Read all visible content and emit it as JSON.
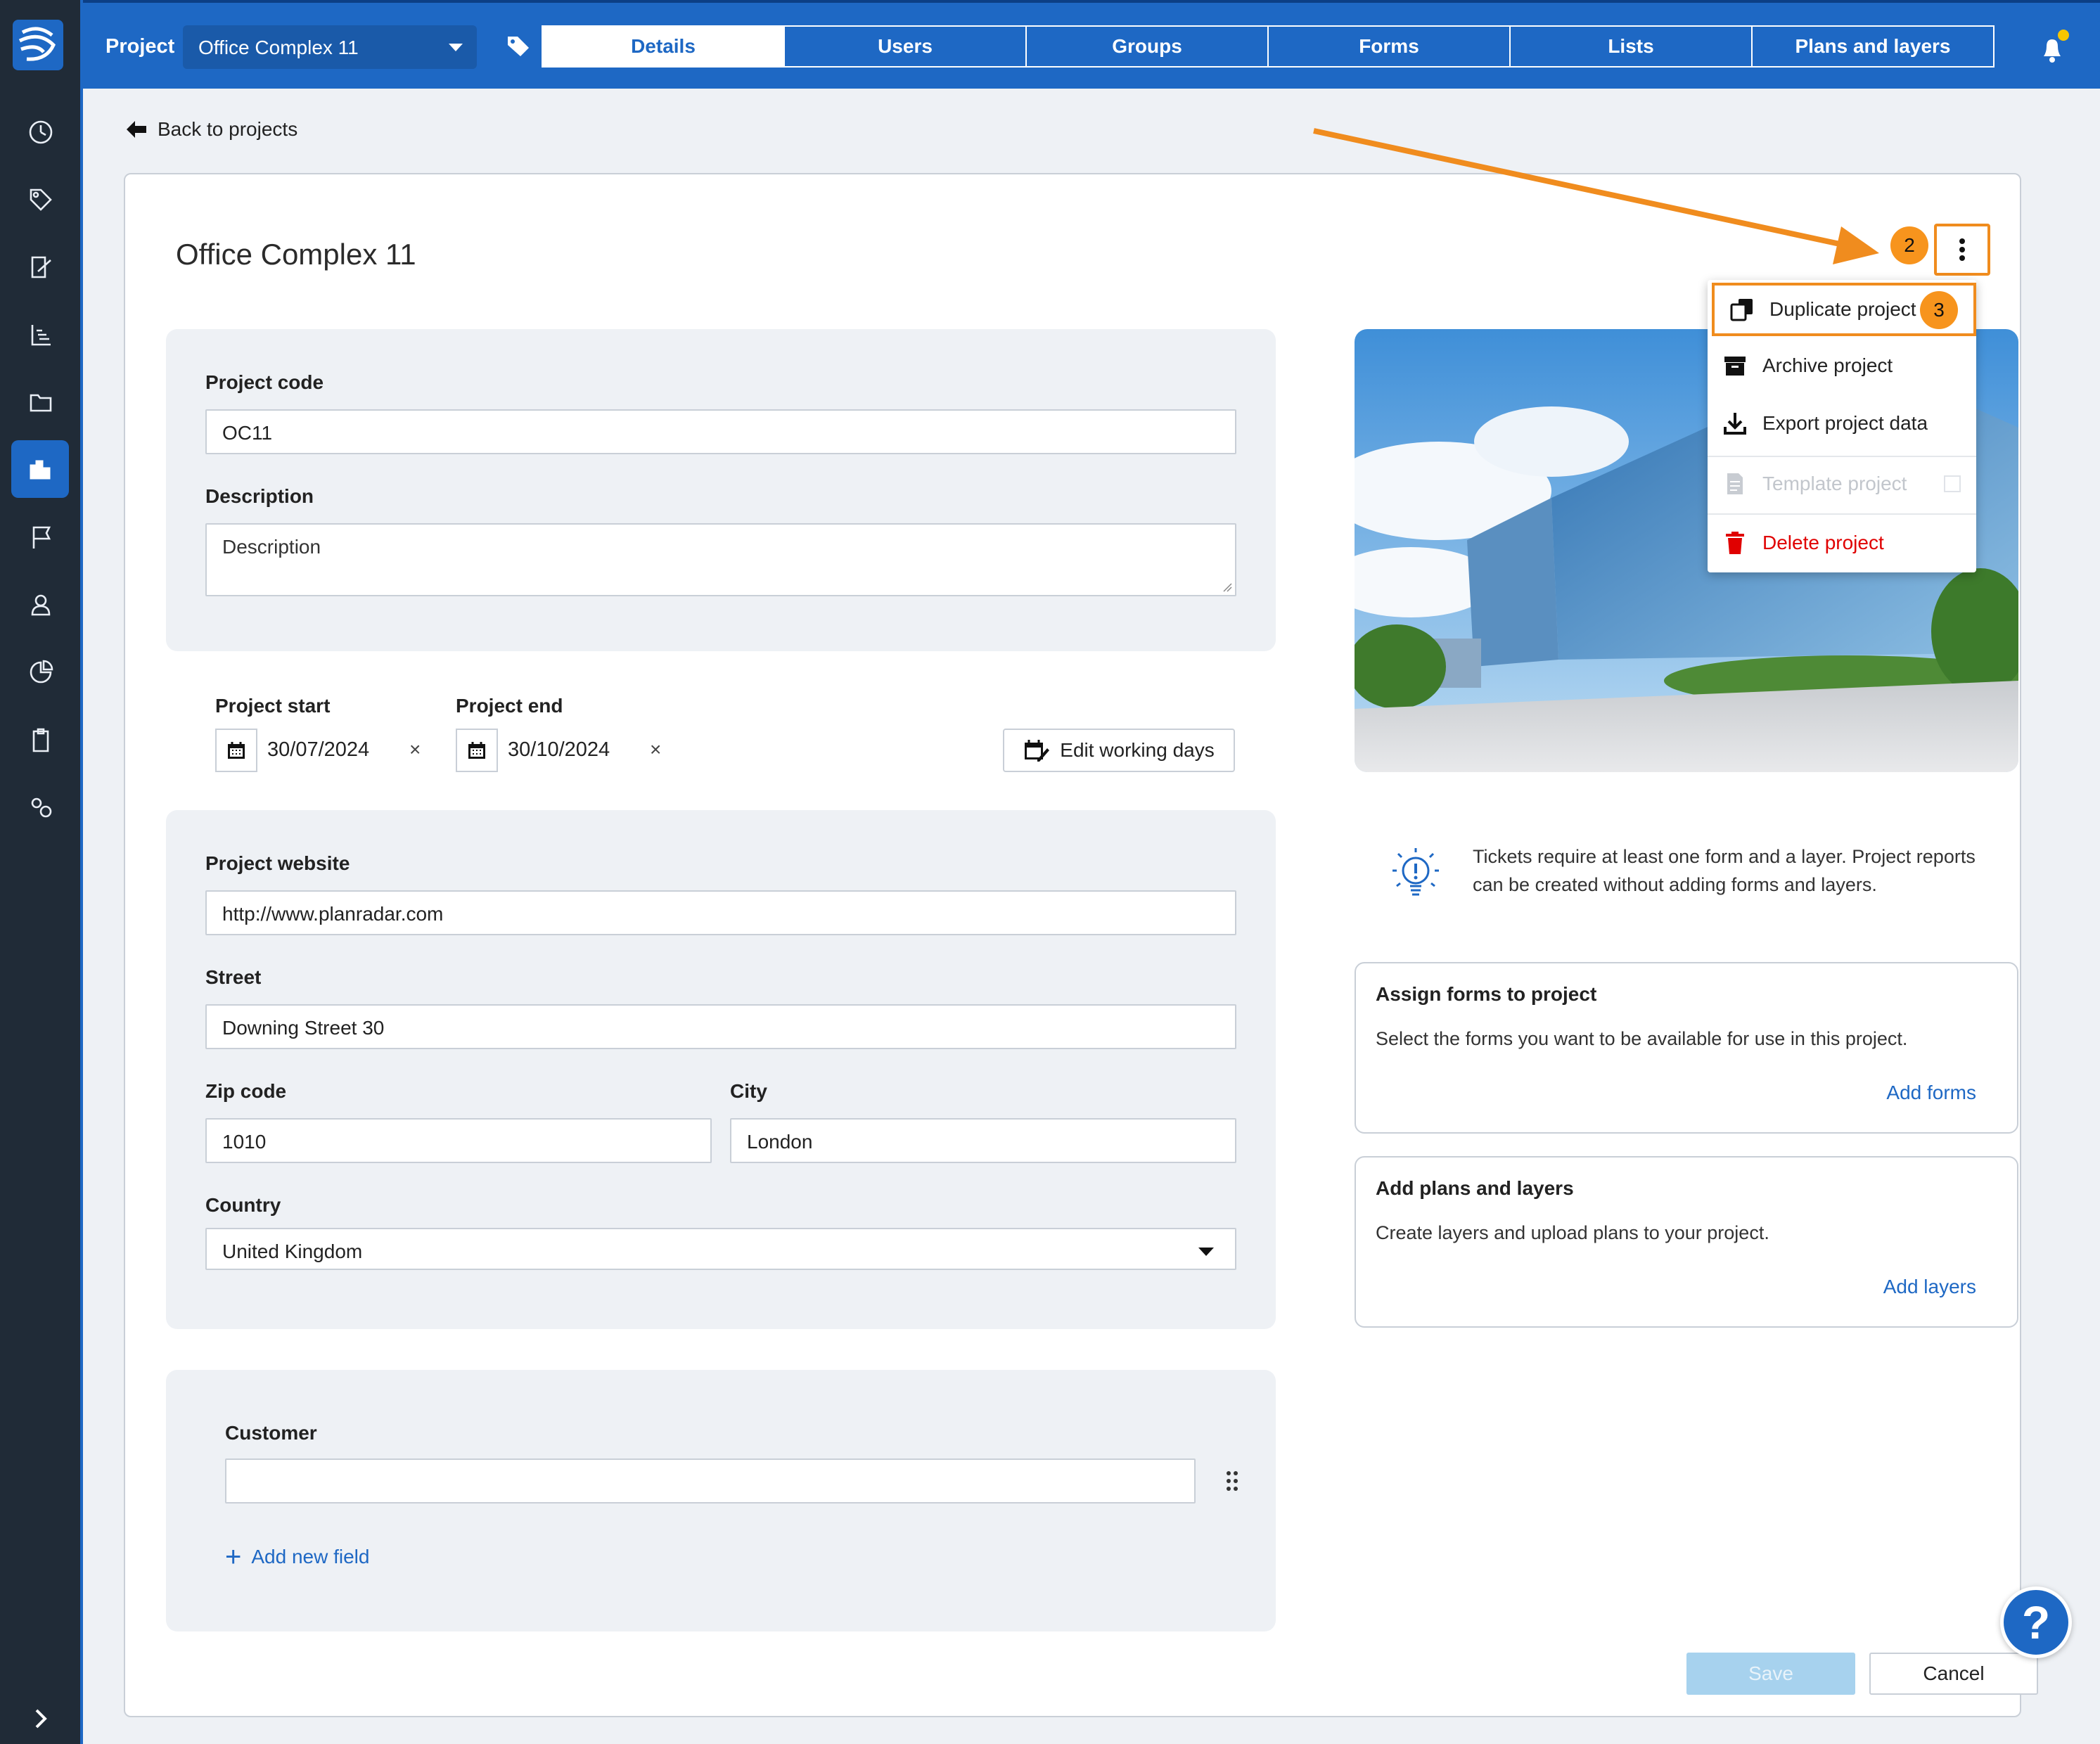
{
  "topbar": {
    "project_label": "Project",
    "project_select": "Office Complex 11",
    "tabs": [
      {
        "label": "Details",
        "active": true
      },
      {
        "label": "Users"
      },
      {
        "label": "Groups"
      },
      {
        "label": "Forms"
      },
      {
        "label": "Lists"
      },
      {
        "label": "Plans and layers"
      }
    ],
    "accent": "#1e68c4",
    "notification_dot": "#f7c600"
  },
  "back_link": "Back to projects",
  "page_title": "Office Complex 11",
  "fields": {
    "project_code": {
      "label": "Project code",
      "value": "OC11"
    },
    "description": {
      "label": "Description",
      "placeholder": "Description"
    },
    "project_start": {
      "label": "Project start",
      "value": "30/07/2024"
    },
    "project_end": {
      "label": "Project end",
      "value": "30/10/2024"
    },
    "clear_symbol": "×",
    "edit_working_days": "Edit working days",
    "website": {
      "label": "Project website",
      "value": "http://www.planradar.com"
    },
    "street": {
      "label": "Street",
      "value": "Downing Street 30"
    },
    "zip": {
      "label": "Zip code",
      "value": "1010"
    },
    "city": {
      "label": "City",
      "value": "London"
    },
    "country": {
      "label": "Country",
      "value": "United Kingdom"
    },
    "customer": {
      "label": "Customer",
      "value": ""
    },
    "add_new_field": "Add new field"
  },
  "hint": "Tickets require at least one form and a layer. Project reports can be created without adding forms and layers.",
  "forms_card": {
    "title": "Assign forms to project",
    "desc": "Select the forms you want to be available for use in this project.",
    "link": "Add forms"
  },
  "layers_card": {
    "title": "Add plans and layers",
    "desc": "Create layers and upload plans to your project.",
    "link": "Add layers"
  },
  "buttons": {
    "save": "Save",
    "cancel": "Cancel",
    "help": "?"
  },
  "menu": {
    "items": [
      {
        "label": "Duplicate project",
        "icon": "copy-icon"
      },
      {
        "label": "Archive project",
        "icon": "archive-icon"
      },
      {
        "label": "Export project data",
        "icon": "download-icon"
      },
      {
        "label": "Template project",
        "icon": "document-icon",
        "disabled": true
      },
      {
        "label": "Delete project",
        "icon": "trash-icon",
        "danger": true
      }
    ]
  },
  "annotations": {
    "step_kebab": "2",
    "step_duplicate": "3",
    "color": "#f08c1e"
  }
}
